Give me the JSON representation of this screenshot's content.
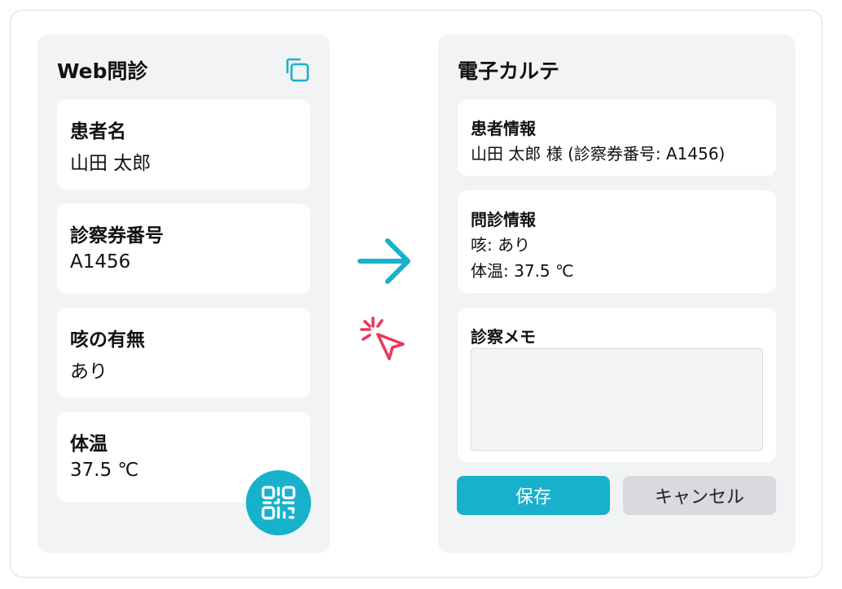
{
  "colors": {
    "accent": "#17b1cc",
    "cursor": "#e8385b",
    "panel_bg": "#f2f3f4",
    "cancel_bg": "#d8dadd"
  },
  "web_form": {
    "title": "Web問診",
    "copy_icon": "copy-icon",
    "fields": [
      {
        "label": "患者名",
        "value": "山田 太郎"
      },
      {
        "label": "診察券番号",
        "value": "A1456"
      },
      {
        "label": "咳の有無",
        "value": "あり"
      },
      {
        "label": "体温",
        "value": "37.5 ℃"
      }
    ],
    "qr_icon": "qr-code-icon"
  },
  "transfer_icons": {
    "arrow": "arrow-right-icon",
    "cursor": "click-cursor-icon"
  },
  "emr": {
    "title": "電子カルテ",
    "patient_info": {
      "label": "患者情報",
      "text": "山田 太郎 様 (診察券番号: A1456)"
    },
    "interview_info": {
      "label": "問診情報",
      "lines": [
        "咳: あり",
        "体温: 37.5 ℃"
      ]
    },
    "memo": {
      "label": "診察メモ",
      "value": ""
    },
    "buttons": {
      "save": "保存",
      "cancel": "キャンセル"
    }
  }
}
